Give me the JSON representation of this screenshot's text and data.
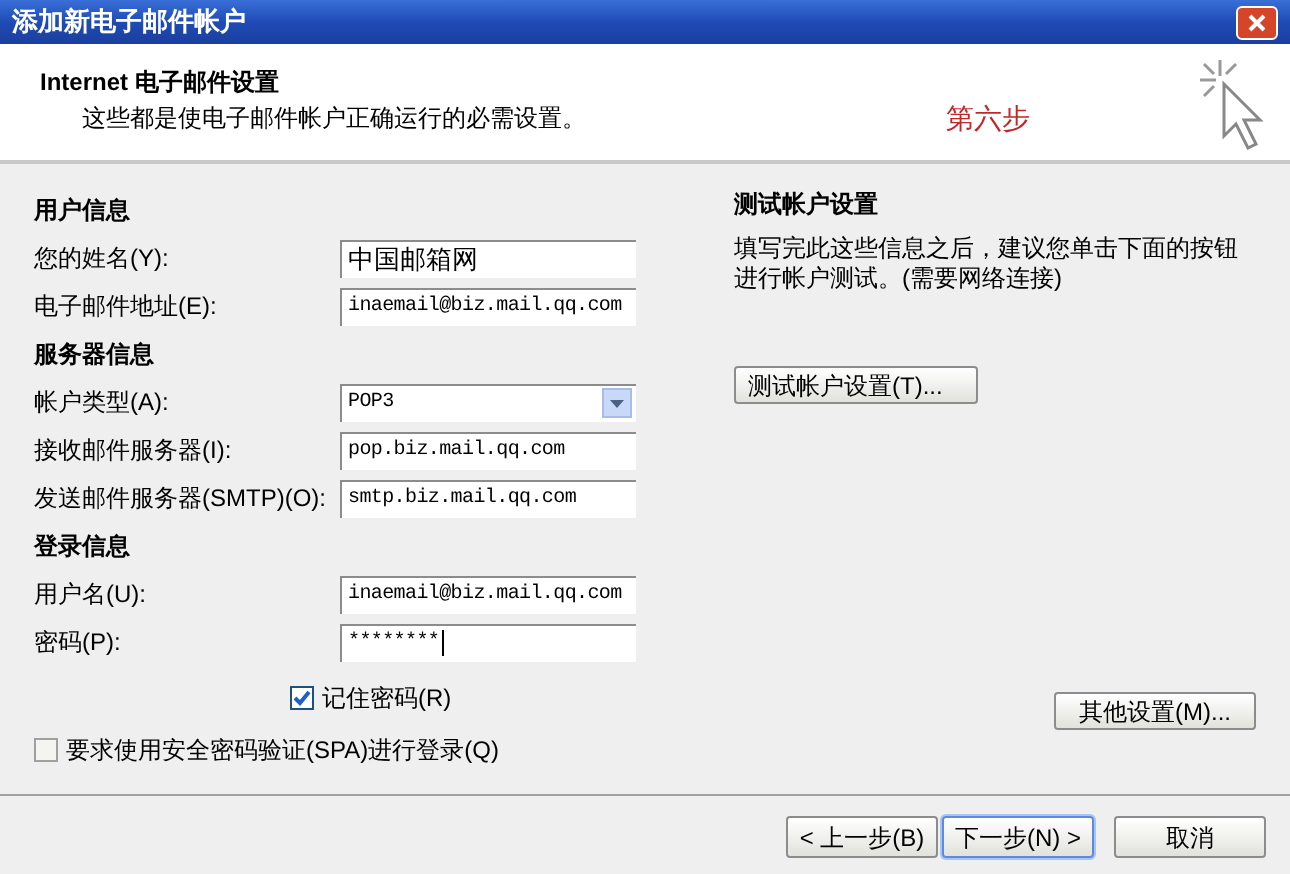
{
  "window": {
    "title": "添加新电子邮件帐户"
  },
  "header": {
    "title": "Internet 电子邮件设置",
    "subtitle": "这些都是使电子邮件帐户正确运行的必需设置。",
    "step": "第六步"
  },
  "groups": [
    {
      "heading": "用户信息",
      "fields": [
        {
          "kind": "text",
          "label": "您的姓名(Y):",
          "value": "中国邮箱网"
        },
        {
          "kind": "text",
          "label": "电子邮件地址(E):",
          "value": "inaemail@biz.mail.qq.com"
        }
      ]
    },
    {
      "heading": "服务器信息",
      "fields": [
        {
          "kind": "dropdown",
          "label": "帐户类型(A):",
          "value": "POP3"
        },
        {
          "kind": "text",
          "label": "接收邮件服务器(I):",
          "value": "pop.biz.mail.qq.com"
        },
        {
          "kind": "text",
          "label": "发送邮件服务器(SMTP)(O):",
          "value": "smtp.biz.mail.qq.com"
        }
      ]
    },
    {
      "heading": "登录信息",
      "fields": [
        {
          "kind": "text",
          "label": "用户名(U):",
          "value": "inaemail@biz.mail.qq.com"
        },
        {
          "kind": "password",
          "label": "密码(P):",
          "value": "********"
        }
      ]
    }
  ],
  "remember_password": {
    "label": "记住密码(R)",
    "checked": true
  },
  "require_spa": {
    "label": "要求使用安全密码验证(SPA)进行登录(Q)",
    "checked": false
  },
  "test": {
    "heading": "测试帐户设置",
    "description": "填写完此这些信息之后，建议您单击下面的按钮进行帐户测试。(需要网络连接)",
    "button": "测试帐户设置(T)..."
  },
  "more_settings_button": "其他设置(M)...",
  "footer_buttons": [
    {
      "label": "< 上一步(B)",
      "focused": false
    },
    {
      "label": "下一步(N) >",
      "focused": true
    },
    {
      "label": "取消",
      "focused": false
    }
  ]
}
